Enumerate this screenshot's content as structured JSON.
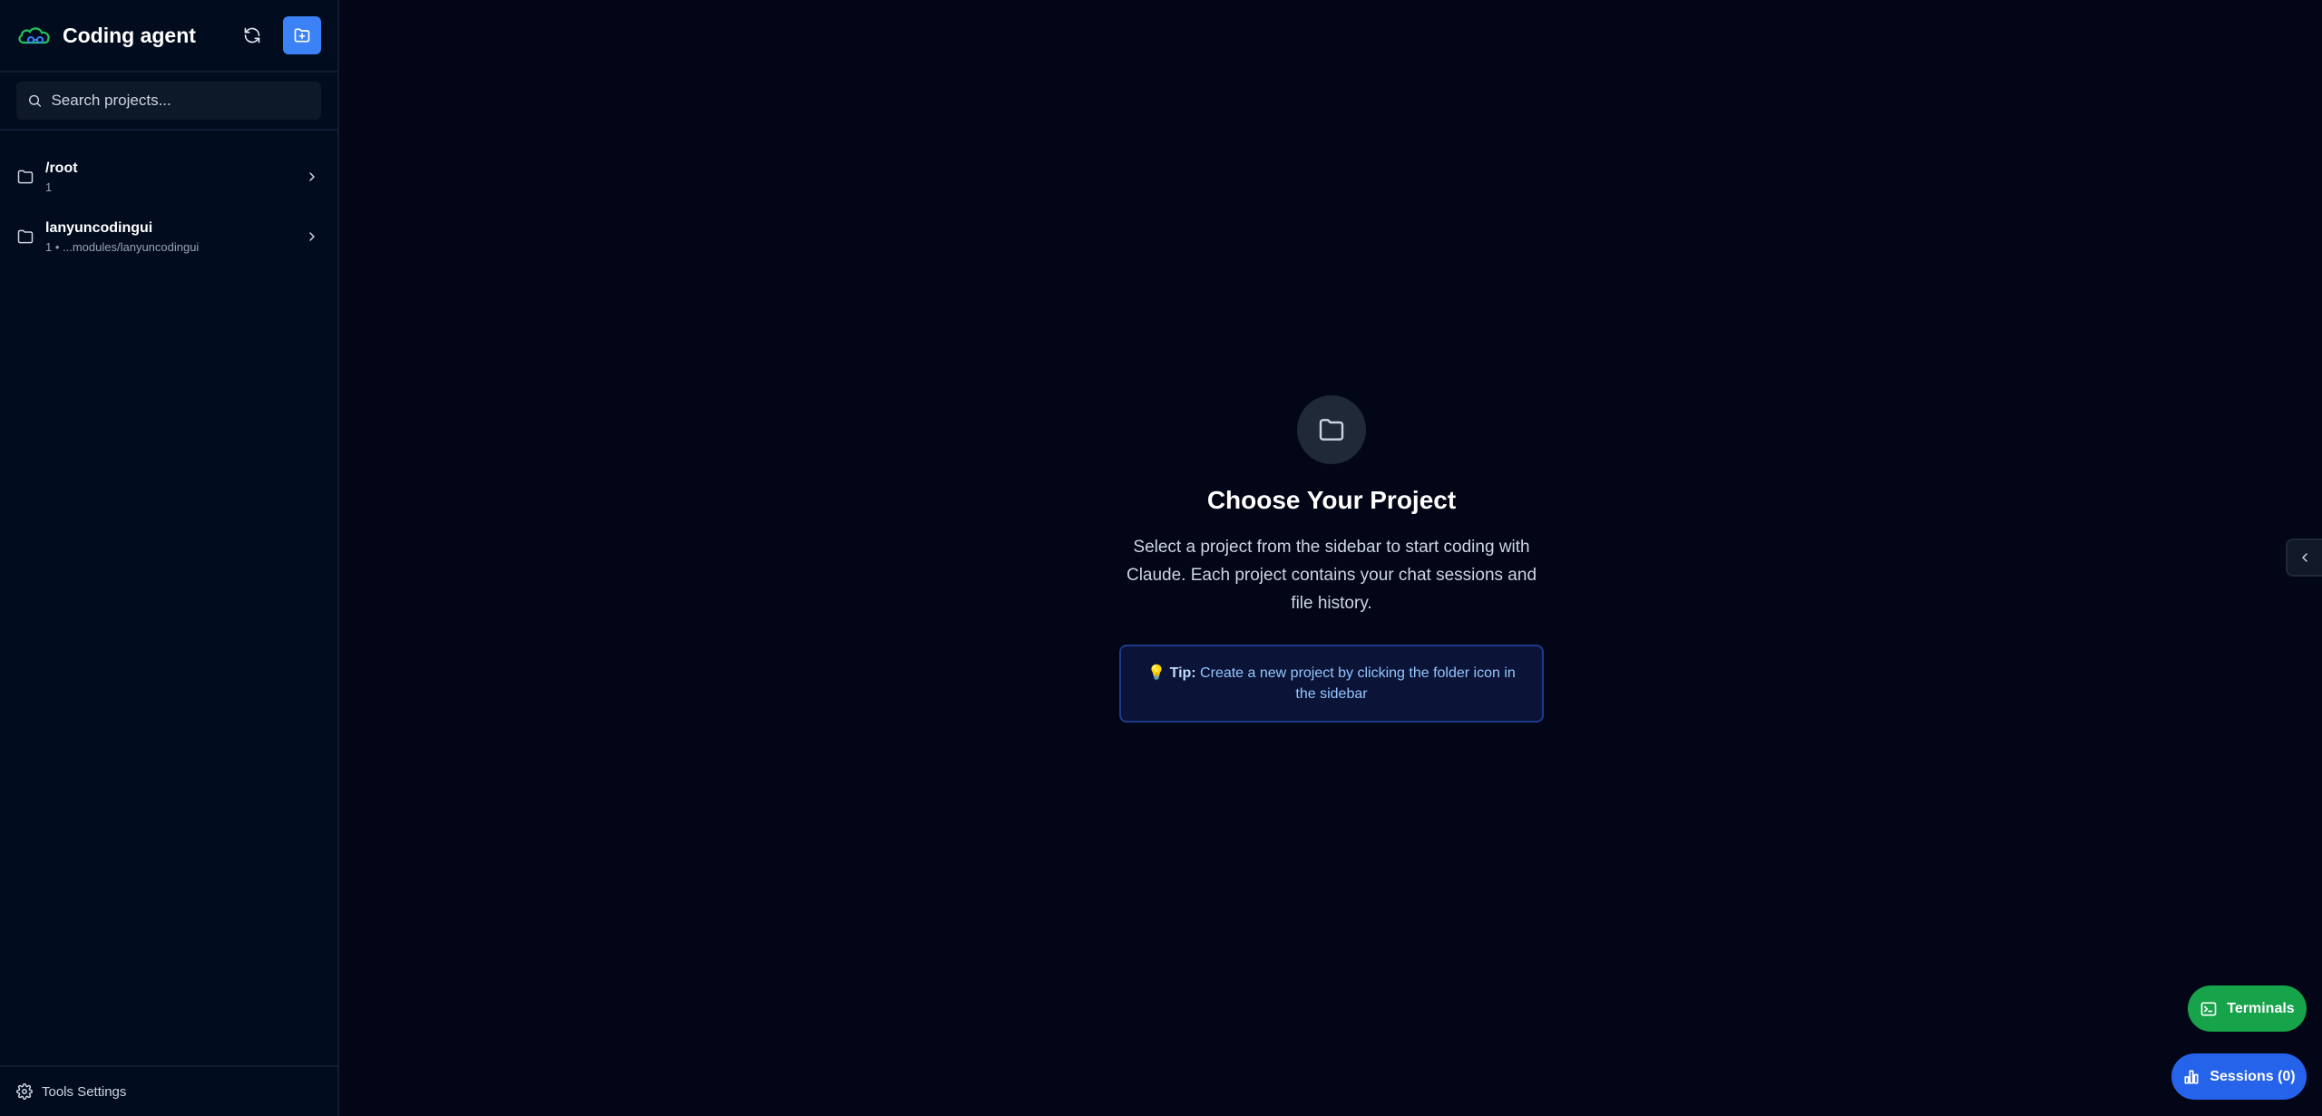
{
  "app": {
    "title": "Coding agent",
    "accent": "#3b82f6"
  },
  "sidebar": {
    "search_placeholder": "Search projects...",
    "projects": [
      {
        "name": "/root",
        "meta": "1"
      },
      {
        "name": "lanyuncodingui",
        "meta": "1 • ...modules/lanyuncodingui"
      }
    ],
    "footer_label": "Tools Settings",
    "icons": {
      "logo": "cloud-agent-logo-icon",
      "refresh": "refresh-icon",
      "new_project": "folder-plus-icon",
      "search": "search-icon",
      "folder": "folder-icon",
      "chevron": "chevron-right-icon",
      "settings": "gear-icon"
    }
  },
  "main": {
    "title": "Choose Your Project",
    "description": "Select a project from the sidebar to start coding with Claude. Each project contains your chat sessions and file history.",
    "tip_emoji": "💡",
    "tip_label": "Tip:",
    "tip_text": " Create a new project by clicking the folder icon in the sidebar"
  },
  "floating": {
    "terminals_label": "Terminals",
    "terminals_color": "#16a34a",
    "sessions_label": "Sessions (0)",
    "sessions_color": "#2563eb"
  }
}
